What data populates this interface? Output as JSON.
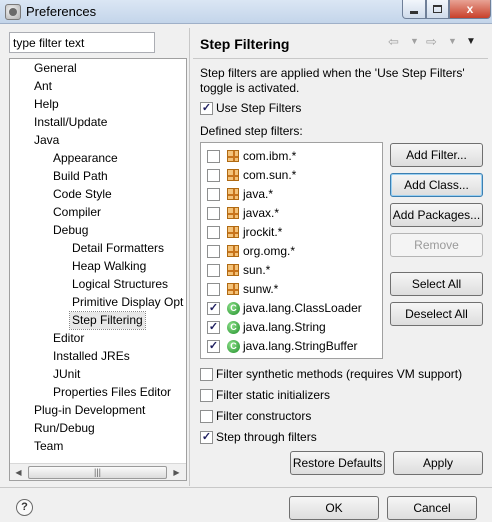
{
  "window": {
    "title": "Preferences",
    "minimize": "",
    "maximize": "",
    "close": "x"
  },
  "filter": {
    "value": "type filter text"
  },
  "tree": {
    "items": [
      {
        "label": "General",
        "level": 1
      },
      {
        "label": "Ant",
        "level": 1
      },
      {
        "label": "Help",
        "level": 1
      },
      {
        "label": "Install/Update",
        "level": 1
      },
      {
        "label": "Java",
        "level": 1
      },
      {
        "label": "Appearance",
        "level": 2
      },
      {
        "label": "Build Path",
        "level": 2
      },
      {
        "label": "Code Style",
        "level": 2
      },
      {
        "label": "Compiler",
        "level": 2
      },
      {
        "label": "Debug",
        "level": 2
      },
      {
        "label": "Detail Formatters",
        "level": 3
      },
      {
        "label": "Heap Walking",
        "level": 3
      },
      {
        "label": "Logical Structures",
        "level": 3
      },
      {
        "label": "Primitive Display Opt",
        "level": 3
      },
      {
        "label": "Step Filtering",
        "level": 3,
        "selected": true
      },
      {
        "label": "Editor",
        "level": 2
      },
      {
        "label": "Installed JREs",
        "level": 2
      },
      {
        "label": "JUnit",
        "level": 2
      },
      {
        "label": "Properties Files Editor",
        "level": 2
      },
      {
        "label": "Plug-in Development",
        "level": 1
      },
      {
        "label": "Run/Debug",
        "level": 1
      },
      {
        "label": "Team",
        "level": 1
      }
    ],
    "scroll_left": "◀",
    "scroll_right": "▶",
    "scroll_grip": "|||"
  },
  "page": {
    "title": "Step Filtering",
    "nav_back": "⇦",
    "nav_forward": "⇨",
    "nav_drop": "▼",
    "view_menu": "▼",
    "description": "Step filters are applied when the 'Use Step Filters' toggle is activated.",
    "use_step_filters": {
      "label": "Use Step Filters",
      "checked": true
    },
    "defined_label": "Defined step filters:",
    "filters": [
      {
        "name": "com.ibm.*",
        "checked": false,
        "icon": "package-icon"
      },
      {
        "name": "com.sun.*",
        "checked": false,
        "icon": "package-icon"
      },
      {
        "name": "java.*",
        "checked": false,
        "icon": "package-icon"
      },
      {
        "name": "javax.*",
        "checked": false,
        "icon": "package-icon"
      },
      {
        "name": "jrockit.*",
        "checked": false,
        "icon": "package-icon"
      },
      {
        "name": "org.omg.*",
        "checked": false,
        "icon": "package-icon"
      },
      {
        "name": "sun.*",
        "checked": false,
        "icon": "package-icon"
      },
      {
        "name": "sunw.*",
        "checked": false,
        "icon": "package-icon"
      },
      {
        "name": "java.lang.ClassLoader",
        "checked": true,
        "icon": "class-icon"
      },
      {
        "name": "java.lang.String",
        "checked": true,
        "icon": "class-icon"
      },
      {
        "name": "java.lang.StringBuffer",
        "checked": true,
        "icon": "class-icon"
      }
    ],
    "buttons": {
      "add_filter": "Add Filter...",
      "add_class": "Add Class...",
      "add_packages": "Add Packages...",
      "remove": "Remove",
      "select_all": "Select All",
      "deselect_all": "Deselect All"
    },
    "options": [
      {
        "label": "Filter synthetic methods (requires VM support)",
        "checked": false
      },
      {
        "label": "Filter static initializers",
        "checked": false
      },
      {
        "label": "Filter constructors",
        "checked": false
      },
      {
        "label": "Step through filters",
        "checked": true
      }
    ],
    "restore_defaults": "Restore Defaults",
    "apply": "Apply"
  },
  "footer": {
    "help": "?",
    "ok": "OK",
    "cancel": "Cancel"
  },
  "check_mark": "✓",
  "class_glyph": "C",
  "colors": {
    "titlebar": "#c4d5ea",
    "close_button": "#c8402a",
    "package_icon": "#f4c37a",
    "class_icon": "#1f8f2a"
  }
}
